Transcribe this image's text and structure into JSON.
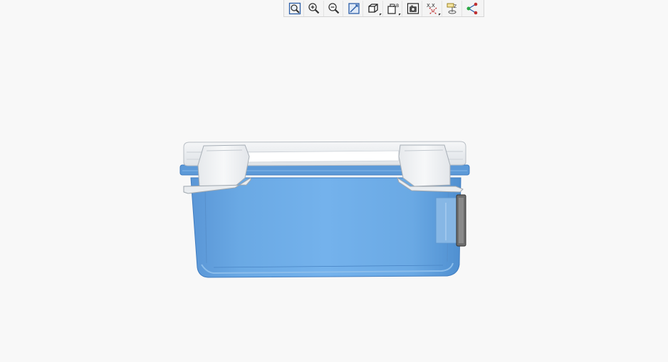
{
  "toolbar": {
    "buttons": [
      {
        "name": "zoom-fit-button",
        "icon": "zoom-fit-icon"
      },
      {
        "name": "zoom-in-button",
        "icon": "zoom-in-icon"
      },
      {
        "name": "zoom-out-button",
        "icon": "zoom-out-icon"
      },
      {
        "name": "repaint-button",
        "icon": "repaint-icon"
      },
      {
        "name": "display-style-button",
        "icon": "display-style-icon",
        "dropdown": true
      },
      {
        "name": "saved-views-button",
        "icon": "saved-views-icon",
        "dropdown": true
      },
      {
        "name": "view-manager-button",
        "icon": "camera-icon"
      },
      {
        "name": "datum-display-button",
        "icon": "datum-display-icon",
        "dropdown": true
      },
      {
        "name": "annotation-display-button",
        "icon": "annotation-display-icon"
      },
      {
        "name": "spin-center-button",
        "icon": "spin-center-icon"
      }
    ],
    "datum_label": "X,X",
    "saved_views_label": "AB",
    "annotation_label": "Z"
  },
  "colors": {
    "background": "#f8f8f8",
    "container_blue": "#6aa9e4",
    "container_blue_dark": "#4f8fd0",
    "lid_white": "#f2f4f6",
    "clip_white": "#eef0f2",
    "latch_dark": "#555555",
    "icon_blue": "#2b5ea8",
    "icon_red": "#c03030"
  }
}
